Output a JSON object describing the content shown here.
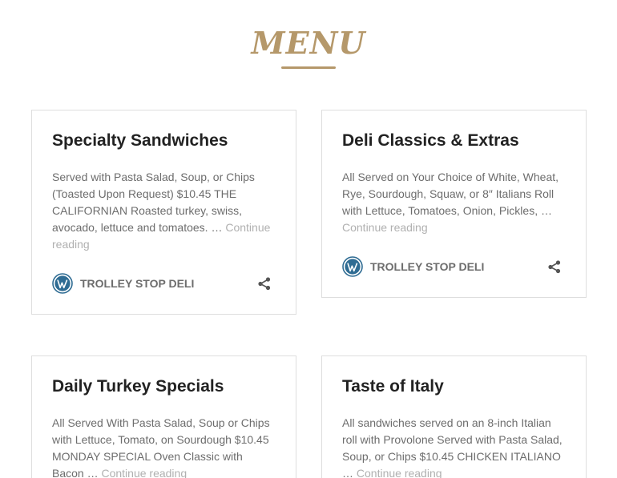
{
  "colors": {
    "accent": "#b5986a",
    "text": "#222222",
    "muted": "#6d6d6d",
    "link": "#b0b0b0",
    "border": "#dedede",
    "avatar": "#2f6c93"
  },
  "header": {
    "title": "MENU"
  },
  "posts": [
    {
      "title": "Specialty Sandwiches",
      "excerpt": "Served with Pasta Salad, Soup, or Chips (Toasted Upon Request) $10.45 THE CALIFORNIAN Roasted turkey, swiss, avocado, lettuce and tomatoes. …",
      "continue_label": "Continue reading",
      "author": "TROLLEY STOP DELI",
      "author_icon": "wordpress-icon",
      "share_icon": "share-icon"
    },
    {
      "title": "Deli Classics & Extras",
      "excerpt": "All Served on Your Choice of White, Wheat, Rye, Sourdough, Squaw, or 8″ Italians Roll with Lettuce, Tomatoes, Onion, Pickles, …",
      "continue_label": "Continue reading",
      "author": "TROLLEY STOP DELI",
      "author_icon": "wordpress-icon",
      "share_icon": "share-icon"
    },
    {
      "title": "Daily Turkey Specials",
      "excerpt": "All Served With Pasta Salad, Soup or Chips with Lettuce, Tomato, on Sourdough $10.45 MONDAY SPECIAL Oven Classic with Bacon …",
      "continue_label": "Continue reading"
    },
    {
      "title": "Taste of Italy",
      "excerpt": "All sandwiches served on an 8-inch Italian roll with Provolone Served with Pasta Salad, Soup, or Chips $10.45 CHICKEN ITALIANO …",
      "continue_label": "Continue reading"
    }
  ]
}
